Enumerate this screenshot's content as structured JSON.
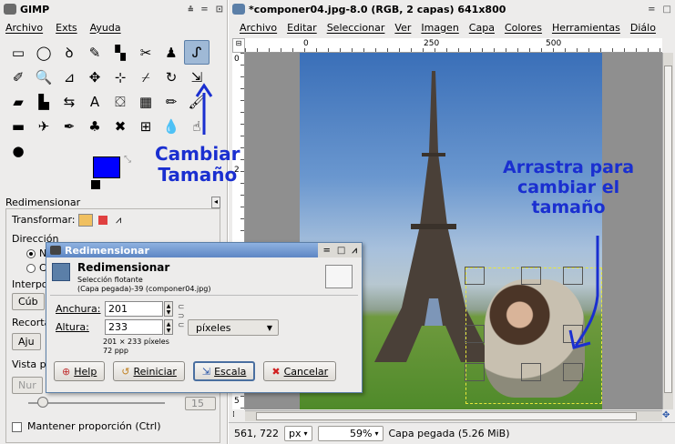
{
  "toolbox": {
    "title": "GIMP",
    "menus": [
      "Archivo",
      "Exts",
      "Ayuda"
    ],
    "tools": [
      {
        "name": "rect-select-icon",
        "glyph": "▭"
      },
      {
        "name": "ellipse-select-icon",
        "glyph": "◯"
      },
      {
        "name": "lasso-icon",
        "glyph": "ꝺ"
      },
      {
        "name": "fuzzy-select-icon",
        "glyph": "✎"
      },
      {
        "name": "color-select-icon",
        "glyph": "▚"
      },
      {
        "name": "scissors-icon",
        "glyph": "✂"
      },
      {
        "name": "foreground-select-icon",
        "glyph": "♟"
      },
      {
        "name": "paths-icon",
        "glyph": "ᔑ"
      },
      {
        "name": "color-picker-icon",
        "glyph": "✐"
      },
      {
        "name": "zoom-icon",
        "glyph": "🔍"
      },
      {
        "name": "measure-icon",
        "glyph": "⊿"
      },
      {
        "name": "move-icon",
        "glyph": "✥"
      },
      {
        "name": "align-icon",
        "glyph": "⊹"
      },
      {
        "name": "crop-icon",
        "glyph": "⌿"
      },
      {
        "name": "rotate-icon",
        "glyph": "↻"
      },
      {
        "name": "scale-icon",
        "glyph": "⇲"
      },
      {
        "name": "shear-icon",
        "glyph": "▰"
      },
      {
        "name": "perspective-icon",
        "glyph": "▙"
      },
      {
        "name": "flip-icon",
        "glyph": "⇆"
      },
      {
        "name": "text-icon",
        "glyph": "A"
      },
      {
        "name": "bucket-fill-icon",
        "glyph": "⛋"
      },
      {
        "name": "blend-icon",
        "glyph": "▦"
      },
      {
        "name": "pencil-icon",
        "glyph": "✏"
      },
      {
        "name": "brush-icon",
        "glyph": "🖌"
      },
      {
        "name": "eraser-icon",
        "glyph": "▬"
      },
      {
        "name": "airbrush-icon",
        "glyph": "✈"
      },
      {
        "name": "ink-icon",
        "glyph": "✒"
      },
      {
        "name": "clone-icon",
        "glyph": "♣"
      },
      {
        "name": "heal-icon",
        "glyph": "✖"
      },
      {
        "name": "perspective-clone-icon",
        "glyph": "⊞"
      },
      {
        "name": "blur-icon",
        "glyph": "💧"
      },
      {
        "name": "smudge-icon",
        "glyph": "☝"
      },
      {
        "name": "dodge-burn-icon",
        "glyph": "●"
      }
    ],
    "active_tool_index": 7,
    "fg_color": "#0000ff",
    "bg_color": "#ff0000"
  },
  "tool_options": {
    "title": "Redimensionar",
    "transform_label": "Transformar:",
    "direction_label": "Dirección",
    "direction_option_1": "N",
    "direction_option_2": "C",
    "interpolation_label": "Interpo",
    "interpolation_value": "Cúb",
    "clip_label": "Recorta",
    "clip_value": "Aju",
    "preview_label": "Vista p",
    "preview_value": "Nur",
    "opacity_value": "15",
    "keep_aspect": "Mantener proporción  (Ctrl)"
  },
  "image_window": {
    "title": "*componer04.jpg-8.0 (RGB, 2 capas) 641x800",
    "menus": [
      "Archivo",
      "Editar",
      "Seleccionar",
      "Ver",
      "Imagen",
      "Capa",
      "Colores",
      "Herramientas",
      "Diálo"
    ],
    "ruler_top_labels": [
      "0",
      "250",
      "500"
    ],
    "ruler_left_labels": [
      "0",
      "2",
      "5"
    ],
    "status": {
      "coords": "561, 722",
      "unit": "px",
      "zoom": "59%",
      "message": "Capa pegada (5.26 MiB)"
    }
  },
  "dialog": {
    "window_title": "Redimensionar",
    "heading": "Redimensionar",
    "subtitle_1": "Selección flotante",
    "subtitle_2": "(Capa pegada)-39 (componer04.jpg)",
    "width_label": "Anchura:",
    "width_value": "201",
    "height_label": "Altura:",
    "height_value": "233",
    "unit": "píxeles",
    "size_info": "201 × 233 píxeles",
    "resolution_info": "72 ppp",
    "buttons": {
      "help": "Help",
      "reset": "Reiniciar",
      "scale": "Escala",
      "cancel": "Cancelar"
    }
  },
  "annotations": {
    "left_1": "Cambiar",
    "left_2": "Tamaño",
    "right_1": "Arrastra para",
    "right_2": "cambiar el",
    "right_3": "tamaño"
  },
  "colors": {
    "annotation": "#1a2fd0",
    "dialog_title": "#5d86c4"
  }
}
